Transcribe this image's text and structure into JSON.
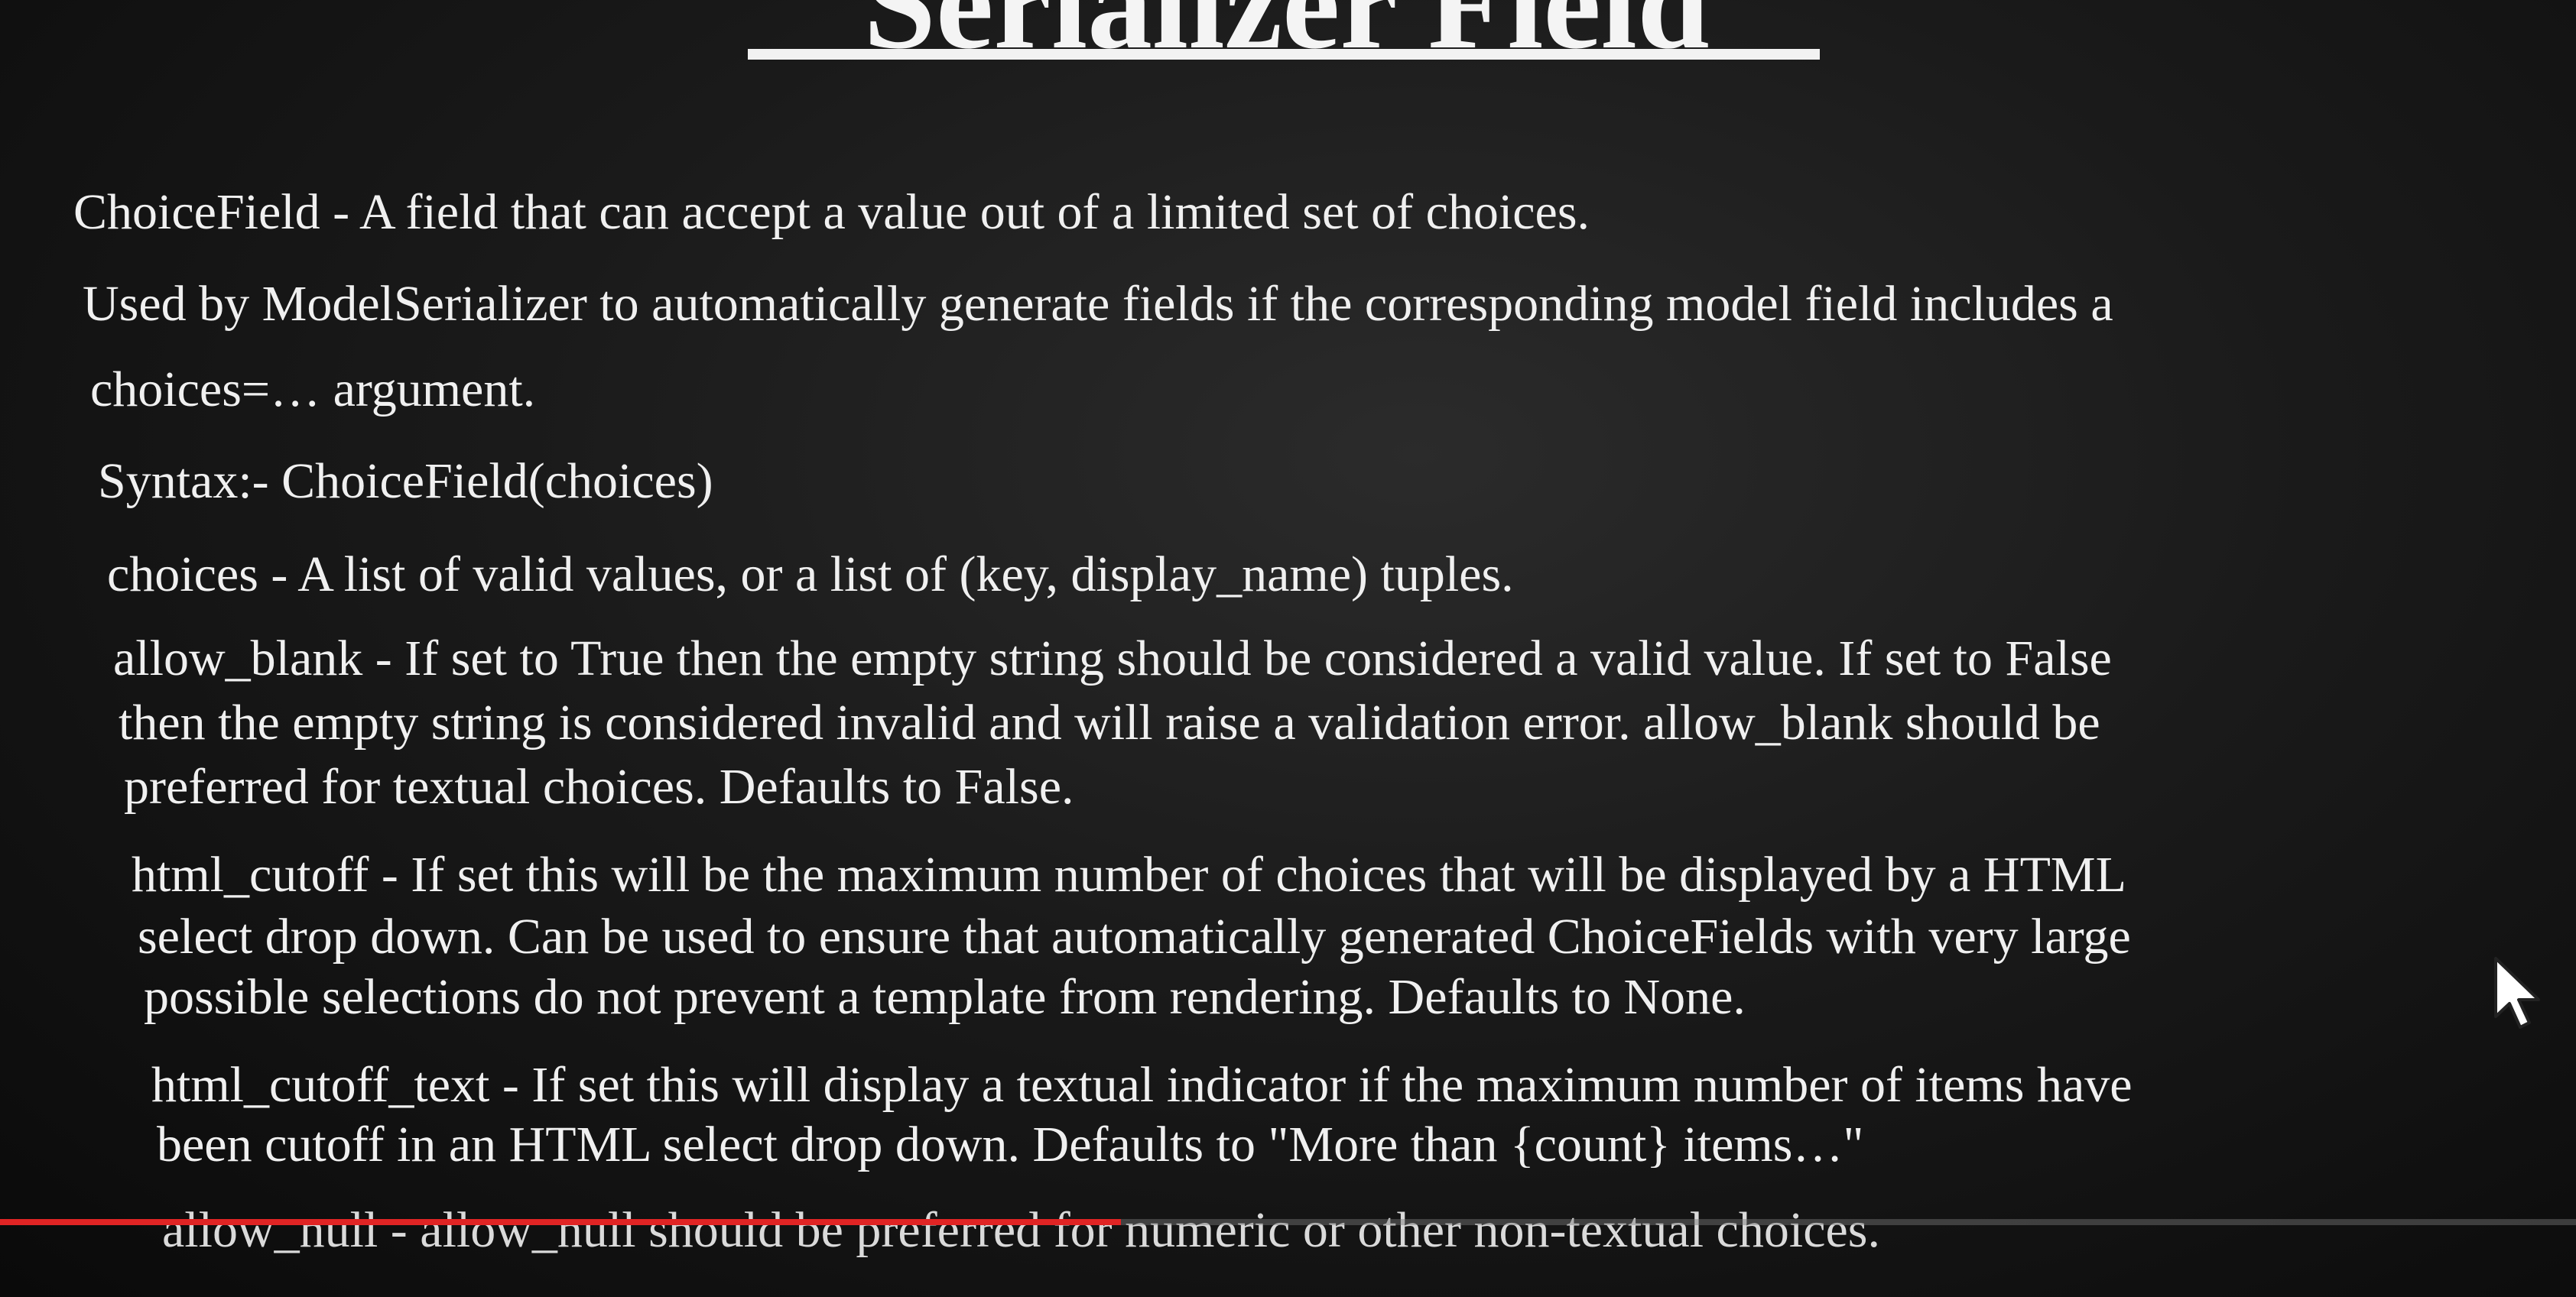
{
  "title": "Serializer Field",
  "paragraphs": {
    "p1": "ChoiceField - A field that can accept a value out of a limited set of choices.",
    "p2_line1": "Used by ModelSerializer to automatically generate fields if the corresponding model field includes a",
    "p2_line2": "choices=… argument.",
    "p3": "Syntax:- ChoiceField(choices)",
    "p4": "choices - A list of valid values, or a list of (key, display_name) tuples.",
    "p5_line1": "allow_blank - If set to True then the empty string should be considered a valid value. If set to False",
    "p5_line2": "then the empty string is considered invalid and will raise a validation error. allow_blank should be",
    "p5_line3": "preferred for textual choices. Defaults to False.",
    "p6_line1": "html_cutoff - If set this will be the maximum number of choices that will be displayed by a HTML",
    "p6_line2": "select drop down. Can be used to ensure that automatically generated ChoiceFields with very large",
    "p6_line3": "possible selections do not prevent a template from rendering. Defaults to None.",
    "p7_line1": "html_cutoff_text - If set this will display a textual indicator if the maximum number of items have",
    "p7_line2": "been cutoff in an HTML select drop down. Defaults to \"More than {count} items…\"",
    "p8": "allow_null - allow_null should be preferred for numeric or other non-textual choices."
  },
  "video_progress": {
    "played_fraction": 0.435,
    "color": "#e02424"
  },
  "cursor": {
    "icon": "mouse-pointer-icon"
  }
}
